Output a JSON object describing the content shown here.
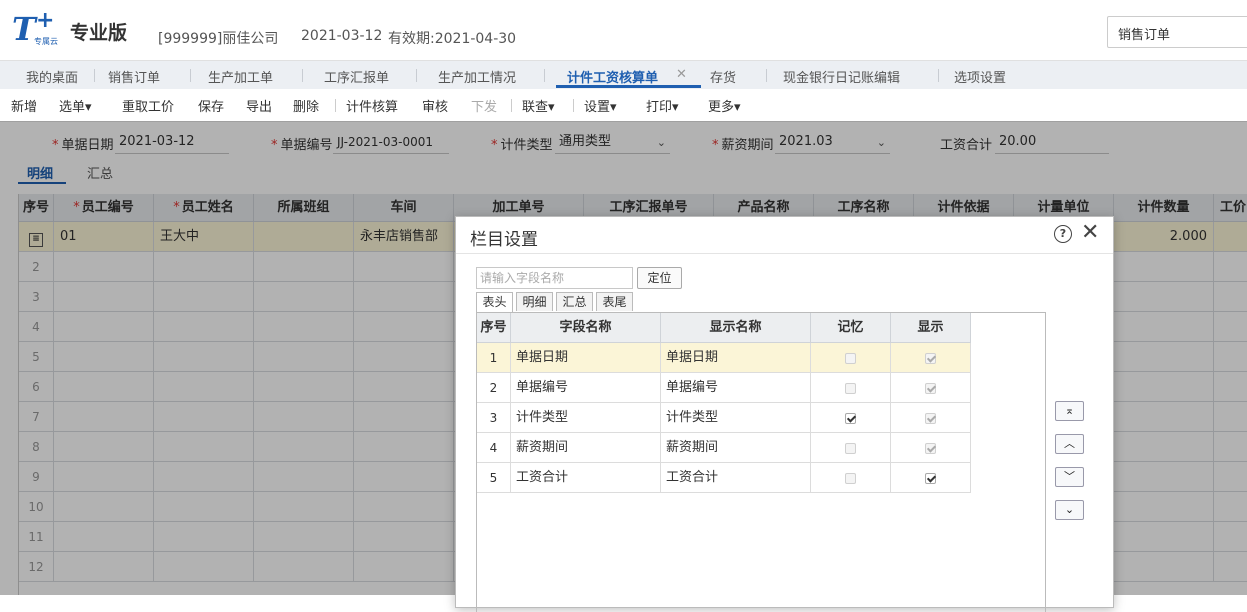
{
  "header": {
    "logo_text": "T",
    "logo_sub": "专属云",
    "edition": "专业版",
    "company": "[999999]丽佳公司",
    "date": "2021-03-12",
    "validity": "有效期:2021-04-30",
    "search_value": "销售订单"
  },
  "tabs": [
    {
      "label": "我的桌面"
    },
    {
      "label": "销售订单"
    },
    {
      "label": "生产加工单"
    },
    {
      "label": "工序汇报单"
    },
    {
      "label": "生产加工情况"
    },
    {
      "label": "计件工资核算单",
      "active": true
    },
    {
      "label": "存货"
    },
    {
      "label": "现金银行日记账编辑"
    },
    {
      "label": "选项设置"
    }
  ],
  "toolbar": {
    "add": "新增",
    "select": "选单",
    "refetch": "重取工价",
    "save": "保存",
    "export": "导出",
    "delete": "删除",
    "calc": "计件核算",
    "audit": "审核",
    "push": "下发",
    "link": "联查",
    "settings": "设置",
    "print": "打印",
    "more": "更多"
  },
  "form": {
    "doc_date_label": "单据日期",
    "doc_date_value": "2021-03-12",
    "doc_no_label": "单据编号",
    "doc_no_value": "JJ-2021-03-0001",
    "type_label": "计件类型",
    "type_value": "通用类型",
    "period_label": "薪资期间",
    "period_value": "2021.03",
    "total_label": "工资合计",
    "total_value": "20.00"
  },
  "subtabs": {
    "detail": "明细",
    "summary": "汇总"
  },
  "grid": {
    "columns": [
      "序号",
      "员工编号",
      "员工姓名",
      "所属班组",
      "车间",
      "加工单号",
      "工序汇报单号",
      "产品名称",
      "工序名称",
      "计件依据",
      "计量单位",
      "计件数量",
      "工价"
    ],
    "row1": {
      "emp_no": "01",
      "emp_name": "王大中",
      "workshop": "永丰店销售部",
      "qty": "2.000"
    },
    "row_numbers": [
      "2",
      "3",
      "4",
      "5",
      "6",
      "7",
      "8",
      "9",
      "10",
      "11",
      "12"
    ]
  },
  "dialog": {
    "title": "栏目设置",
    "help": "?",
    "close": "✕",
    "search_placeholder": "请输入字段名称",
    "locate": "定位",
    "tabs": [
      "表头",
      "明细",
      "汇总",
      "表尾"
    ],
    "columns": [
      "序号",
      "字段名称",
      "显示名称",
      "记忆",
      "显示"
    ],
    "rows": [
      {
        "no": "1",
        "field": "单据日期",
        "display": "单据日期",
        "memory": false,
        "show": true
      },
      {
        "no": "2",
        "field": "单据编号",
        "display": "单据编号",
        "memory": false,
        "show": true
      },
      {
        "no": "3",
        "field": "计件类型",
        "display": "计件类型",
        "memory": true,
        "show": true
      },
      {
        "no": "4",
        "field": "薪资期间",
        "display": "薪资期间",
        "memory": false,
        "show": true
      },
      {
        "no": "5",
        "field": "工资合计",
        "display": "工资合计",
        "memory": false,
        "show": true
      }
    ]
  }
}
